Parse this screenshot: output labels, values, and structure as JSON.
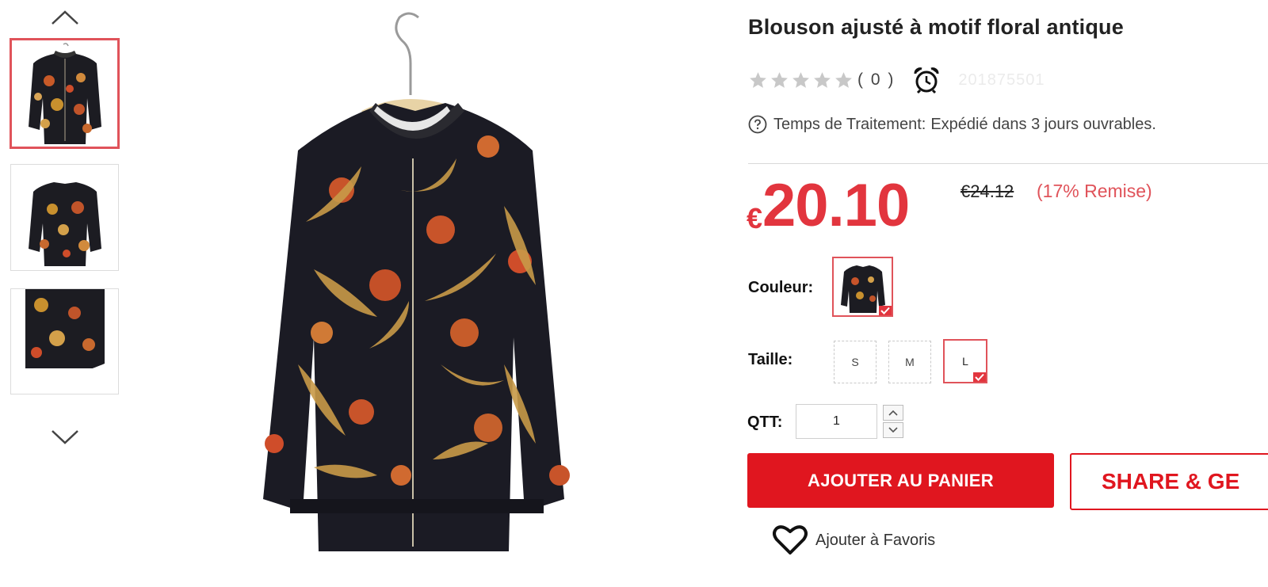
{
  "gallery": {
    "up_icon": "chevron-up-icon",
    "down_icon": "chevron-down-icon",
    "thumbnails": [
      {
        "view": "front",
        "selected": true
      },
      {
        "view": "back",
        "selected": false
      },
      {
        "view": "detail",
        "selected": false
      }
    ]
  },
  "product": {
    "title": "Blouson ajusté à motif floral antique",
    "rating": 0,
    "review_count": "( 0 )",
    "sku": "201875501",
    "processing_label": "Temps de Traitement:",
    "processing_value": "Expédié dans 3 jours ouvrables.",
    "currency": "€",
    "price": "20.10",
    "old_price": "€24.12",
    "discount": "(17% Remise)"
  },
  "options": {
    "color_label": "Couleur:",
    "size_label": "Taille:",
    "sizes": [
      {
        "label": "S",
        "selected": false
      },
      {
        "label": "M",
        "selected": false
      },
      {
        "label": "L",
        "selected": true
      }
    ],
    "qty_label": "QTT:",
    "qty_value": "1"
  },
  "actions": {
    "add_to_cart": "AJOUTER AU PANIER",
    "share": "SHARE & GE",
    "favorite": "Ajouter à Favoris"
  },
  "colors": {
    "accent": "#e0161f",
    "price": "#e2353e",
    "selection_border": "#e0535a",
    "star_empty": "#c8c8c8"
  }
}
